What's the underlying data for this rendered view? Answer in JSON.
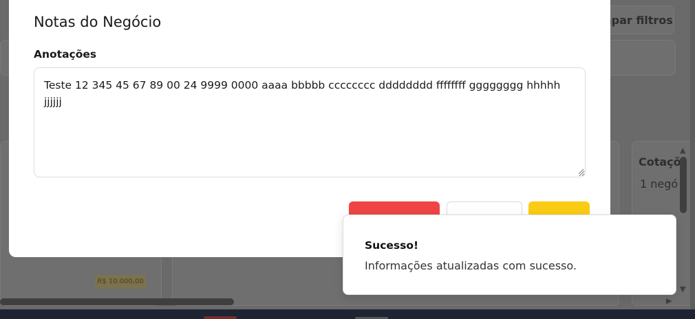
{
  "modal": {
    "title": "Notas do Negócio",
    "field_label": "Anotações",
    "notes_value": "Teste 12 345 45 67 89 00 24 9999 0000 aaaa bbbbb cccccccc dddddddd ffffffff gggggggg hhhhh jjjjjj"
  },
  "toast": {
    "title": "Sucesso!",
    "message": "Informações atualizadas com sucesso."
  },
  "background": {
    "clear_filters_fragment": "mpar filtros",
    "column_title_fragment": "Cotaçõ",
    "column_count_fragment": "1 negó",
    "price_badge": "R$ 10.000,00"
  },
  "colors": {
    "danger": "#ef4444",
    "primary": "#facc15"
  }
}
